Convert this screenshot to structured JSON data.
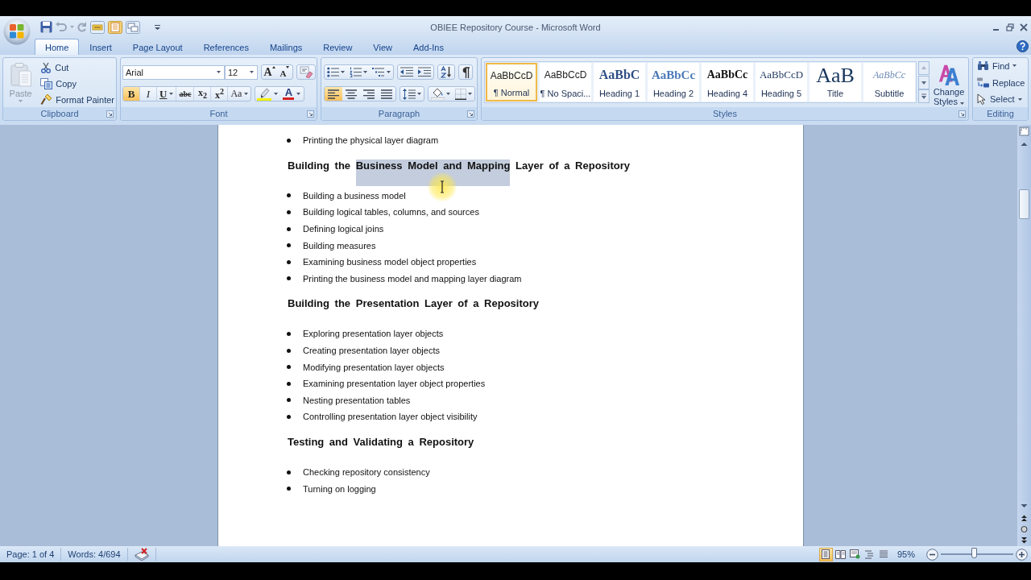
{
  "window": {
    "title": "OBIEE Repository Course - Microsoft Word"
  },
  "tabs": [
    {
      "label": "Home",
      "selected": true
    },
    {
      "label": "Insert",
      "selected": false
    },
    {
      "label": "Page Layout",
      "selected": false
    },
    {
      "label": "References",
      "selected": false
    },
    {
      "label": "Mailings",
      "selected": false
    },
    {
      "label": "Review",
      "selected": false
    },
    {
      "label": "View",
      "selected": false
    },
    {
      "label": "Add-Ins",
      "selected": false
    }
  ],
  "ribbon": {
    "clipboard": {
      "label": "Clipboard",
      "paste": {
        "label": "Paste",
        "disabled": true
      },
      "items": [
        {
          "kind": "cut",
          "label": "Cut"
        },
        {
          "kind": "copy",
          "label": "Copy"
        },
        {
          "kind": "format_painter",
          "label": "Format Painter"
        }
      ]
    },
    "font": {
      "label": "Font",
      "font_name": "Arial",
      "font_size": "12",
      "size_buttons": [
        {
          "kind": "grow",
          "glyph": "A"
        },
        {
          "kind": "shrink",
          "glyph": "A"
        }
      ],
      "format_buttons": [
        {
          "kind": "bold",
          "glyph": "B",
          "on": true
        },
        {
          "kind": "italic",
          "glyph": "I",
          "on": false
        },
        {
          "kind": "underline",
          "glyph": "U",
          "on": false
        },
        {
          "kind": "strikethrough",
          "glyph": "abc",
          "on": false
        },
        {
          "kind": "subscript",
          "glyph": "x$_{2}$",
          "on": false
        },
        {
          "kind": "superscript",
          "glyph": "x$^{2}$",
          "on": false
        },
        {
          "kind": "change_case",
          "glyph": "Aa",
          "on": false
        }
      ],
      "font_color": {
        "glyph": "A"
      }
    },
    "paragraph": {
      "label": "Paragraph",
      "alignment": [
        {
          "kind": "left",
          "selected": true
        },
        {
          "kind": "center",
          "selected": false
        },
        {
          "kind": "right",
          "selected": false
        },
        {
          "kind": "justify",
          "selected": false
        }
      ]
    },
    "styles": {
      "label": "Styles",
      "gallery": [
        {
          "kind": "normal",
          "preview": "AaBbCcD",
          "label": "¶ Normal",
          "selected": true
        },
        {
          "kind": "no_spacing",
          "preview": "AaBbCcD",
          "label": "¶ No Spaci...",
          "selected": false
        },
        {
          "kind": "heading1",
          "preview": "AaBbC",
          "label": "Heading 1",
          "selected": false
        },
        {
          "kind": "heading2",
          "preview": "AaBbCc",
          "label": "Heading 2",
          "selected": false
        },
        {
          "kind": "heading4",
          "preview": "AaBbCc",
          "label": "Heading 4",
          "selected": false
        },
        {
          "kind": "heading5",
          "preview": "AaBbCcD",
          "label": "Heading 5",
          "selected": false
        },
        {
          "kind": "title",
          "preview": "AaB",
          "label": "Title",
          "selected": false
        },
        {
          "kind": "subtitle",
          "preview": "AaBbCc",
          "label": "Subtitle",
          "selected": false
        }
      ],
      "change_styles": "Change Styles"
    },
    "editing": {
      "label": "Editing",
      "items": [
        {
          "kind": "find",
          "label": "Find"
        },
        {
          "kind": "replace",
          "label": "Replace"
        },
        {
          "kind": "select",
          "label": "Select"
        }
      ]
    }
  },
  "document": {
    "blocks": [
      {
        "kind": "bullet",
        "text": "Printing the physical layer diagram"
      },
      {
        "kind": "heading",
        "segments": [
          {
            "text": "Building the ",
            "selected": false
          },
          {
            "text": "Business Model and Mapping",
            "selected": true
          },
          {
            "text": " Layer of a Repository",
            "selected": false
          }
        ]
      },
      {
        "kind": "bullet",
        "text": "Building a business model"
      },
      {
        "kind": "bullet",
        "text": "Building logical tables, columns, and sources"
      },
      {
        "kind": "bullet",
        "text": "Defining logical joins"
      },
      {
        "kind": "bullet",
        "text": "Building measures"
      },
      {
        "kind": "bullet",
        "text": "Examining business model object properties"
      },
      {
        "kind": "bullet",
        "text": "Printing the business model and mapping layer diagram"
      },
      {
        "kind": "heading",
        "segments": [
          {
            "text": "Building the Presentation Layer of a Repository",
            "selected": false
          }
        ]
      },
      {
        "kind": "bullet",
        "text": "Exploring presentation layer objects"
      },
      {
        "kind": "bullet",
        "text": "Creating presentation layer objects"
      },
      {
        "kind": "bullet",
        "text": "Modifying presentation layer objects"
      },
      {
        "kind": "bullet",
        "text": "Examining presentation layer object properties"
      },
      {
        "kind": "bullet",
        "text": "Nesting presentation tables"
      },
      {
        "kind": "bullet",
        "text": "Controlling presentation layer object visibility"
      },
      {
        "kind": "heading",
        "segments": [
          {
            "text": "Testing and Validating a Repository",
            "selected": false
          }
        ]
      },
      {
        "kind": "bullet",
        "text": "Checking repository consistency"
      },
      {
        "kind": "bullet",
        "text": "Turning on logging"
      }
    ]
  },
  "status_bar": {
    "page": "Page: 1 of 4",
    "words": "Words: 4/694",
    "views": [
      {
        "kind": "print_layout",
        "selected": true
      },
      {
        "kind": "full_screen_reading",
        "selected": false
      },
      {
        "kind": "web_layout",
        "selected": false
      },
      {
        "kind": "outline",
        "selected": false
      },
      {
        "kind": "draft",
        "selected": false
      }
    ],
    "zoom": "95%",
    "zoom_slider": {
      "level": 0.47
    }
  }
}
